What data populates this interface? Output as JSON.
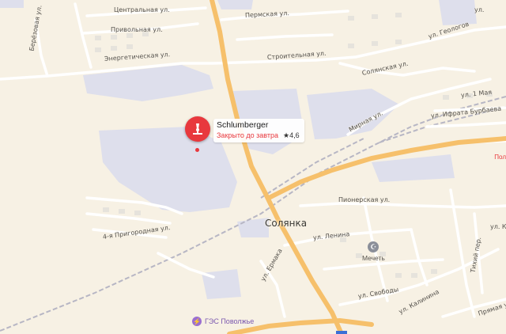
{
  "poi": {
    "name": "Schlumberger",
    "status": "Закрыто до завтра",
    "rating": "★4,6",
    "icon": "microscope-icon",
    "color": "#e8383d"
  },
  "place": {
    "name": "Солянка"
  },
  "streets": {
    "tsentralnaya": "Центральная ул.",
    "privolnaya": "Привольная ул.",
    "beryozovaya": "Берёзовая ул.",
    "energeticheskaya": "Энергетическая ул.",
    "permskaya": "Пермская ул.",
    "stroitelnaya": "Строительная ул.",
    "solyanskaya": "Солянская ул.",
    "geologov": "ул. Геологов",
    "mirnaya": "Мирная ул.",
    "may1": "ул. 1 Мая",
    "ifrata": "ул. Ифрата Бурбаева",
    "pionerskaya": "Пионерская ул.",
    "prigorodnaya4": "4-я Пригородная ул.",
    "lenina": "ул. Ленина",
    "ermaka": "ул. Ермака",
    "svobody": "ул. Свободы",
    "kalinina": "ул. Калинина",
    "tihiy": "Тихий пер.",
    "pryamaya": "Прямая ул.",
    "ki_partial": "ул. Ки",
    "top_partial": "ул."
  },
  "pois": {
    "mosque": {
      "name": "Мечеть",
      "icon": "crescent-icon"
    },
    "ges": {
      "name": "ГЭС Поволжье",
      "icon": "power-icon",
      "color": "#9b6fd0"
    }
  },
  "edge": {
    "red_partial": "Пол"
  },
  "colors": {
    "background": "#f7f1e4",
    "highway": "#f6c06b",
    "road": "#ffffff",
    "industrial": "#dedfec",
    "railway": "#b7b6c4"
  }
}
